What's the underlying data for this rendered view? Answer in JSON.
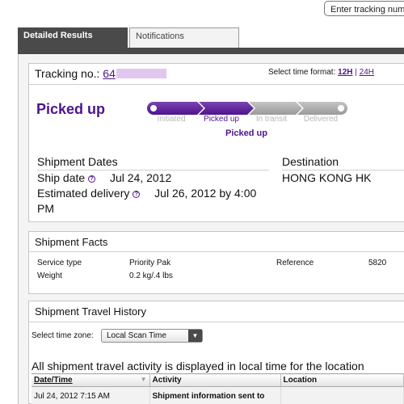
{
  "search": {
    "placeholder": "Enter tracking number"
  },
  "tabs": {
    "detailed": "Detailed Results",
    "notifications": "Notifications"
  },
  "tracking": {
    "label": "Tracking no.:",
    "number_prefix": "64"
  },
  "time_format": {
    "label": "Select time format:",
    "h12": "12H",
    "separator": "|",
    "h24": "24H"
  },
  "status": {
    "title": "Picked up",
    "current_step_label": "Picked up",
    "steps": [
      "Initiated",
      "Picked up",
      "In transit",
      "Delivered"
    ],
    "completed_steps": 2,
    "total_steps": 4
  },
  "dates": {
    "heading": "Shipment Dates",
    "ship_label": "Ship date",
    "ship_value": "Jul 24, 2012",
    "est_label": "Estimated delivery",
    "est_value": "Jul 26, 2012 by 4:00",
    "est_value_cont": "PM"
  },
  "destination": {
    "heading": "Destination",
    "value": "HONG KONG HK"
  },
  "facts": {
    "heading": "Shipment Facts",
    "service_label": "Service type",
    "service_value": "Priority Pak",
    "weight_label": "Weight",
    "weight_value": "0.2 kg/.4 lbs",
    "reference_label": "Reference",
    "reference_value": "5820"
  },
  "travel": {
    "heading": "Shipment Travel History",
    "tz_label": "Select time zone:",
    "tz_value": "Local Scan Time",
    "note": "All shipment travel activity is displayed in local time for the location",
    "columns": [
      "Date/Time",
      "Activity",
      "Location"
    ],
    "rows": [
      {
        "datetime": "Jul 24, 2012 7:15 AM",
        "activity": "Shipment information sent to",
        "location": ""
      }
    ]
  },
  "colors": {
    "accent": "#4d148c",
    "tab_dark": "#4a4a4a",
    "step_inactive": "#a9a9a9"
  },
  "icons": {
    "info": "info-circle-icon",
    "dropdown": "triangle-down-icon",
    "sort": "sort-arrow-icon"
  }
}
